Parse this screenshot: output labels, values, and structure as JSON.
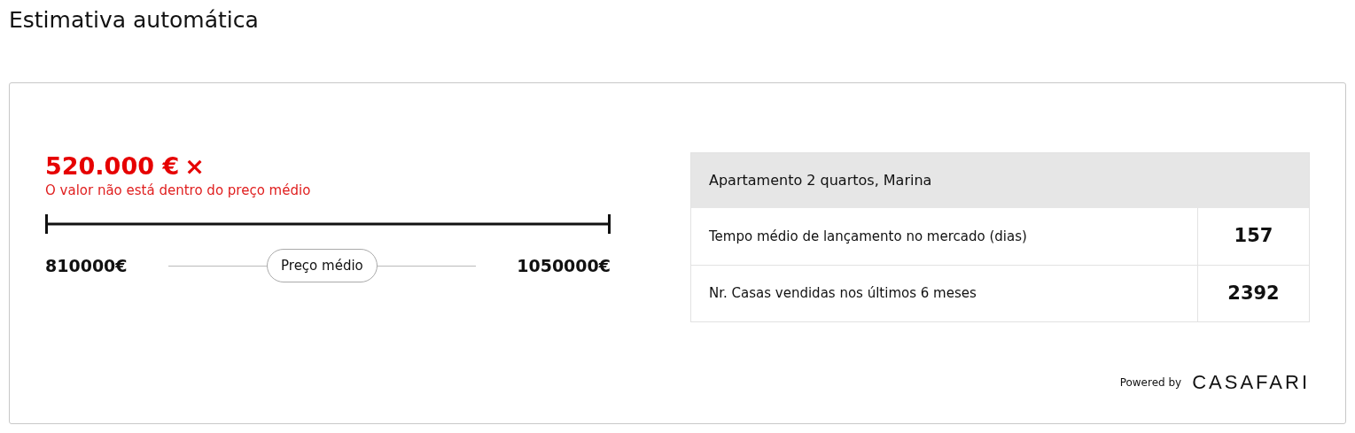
{
  "title": "Estimativa automática",
  "estimate": {
    "price": "520.000 €",
    "status_icon": "×",
    "within_range": false,
    "message": "O valor não está dentro do preço médio",
    "min": "810000€",
    "max": "1050000€",
    "average_label": "Preço médio"
  },
  "table": {
    "header": "Apartamento 2 quartos, Marina",
    "rows": [
      {
        "label": "Tempo médio de lançamento no mercado (dias)",
        "value": "157"
      },
      {
        "label": "Nr. Casas vendidas nos últimos 6 meses",
        "value": "2392"
      }
    ]
  },
  "powered_by": {
    "label": "Powered by",
    "brand": "CASAFARI"
  }
}
